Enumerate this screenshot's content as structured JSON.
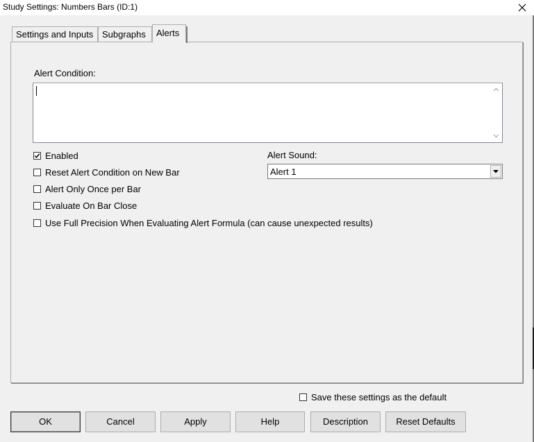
{
  "window": {
    "title": "Study Settings: Numbers Bars (ID:1)"
  },
  "tabs": [
    {
      "label": "Settings and Inputs",
      "active": false
    },
    {
      "label": "Subgraphs",
      "active": false
    },
    {
      "label": "Alerts",
      "active": true
    }
  ],
  "alerts": {
    "condition_label": "Alert Condition:",
    "condition_value": "",
    "sound_label": "Alert Sound:",
    "sound_value": "Alert 1",
    "checkboxes": [
      {
        "label": "Enabled",
        "checked": true
      },
      {
        "label": "Reset Alert Condition on New Bar",
        "checked": false
      },
      {
        "label": "Alert Only Once per Bar",
        "checked": false
      },
      {
        "label": "Evaluate On Bar Close",
        "checked": false
      },
      {
        "label": "Use Full Precision When Evaluating Alert Formula (can cause unexpected results)",
        "checked": false
      }
    ]
  },
  "footer": {
    "save_default_label": "Save these settings as the default",
    "save_default_checked": false,
    "buttons": {
      "ok": "OK",
      "cancel": "Cancel",
      "apply": "Apply",
      "help": "Help",
      "description": "Description",
      "reset_defaults": "Reset Defaults"
    }
  }
}
